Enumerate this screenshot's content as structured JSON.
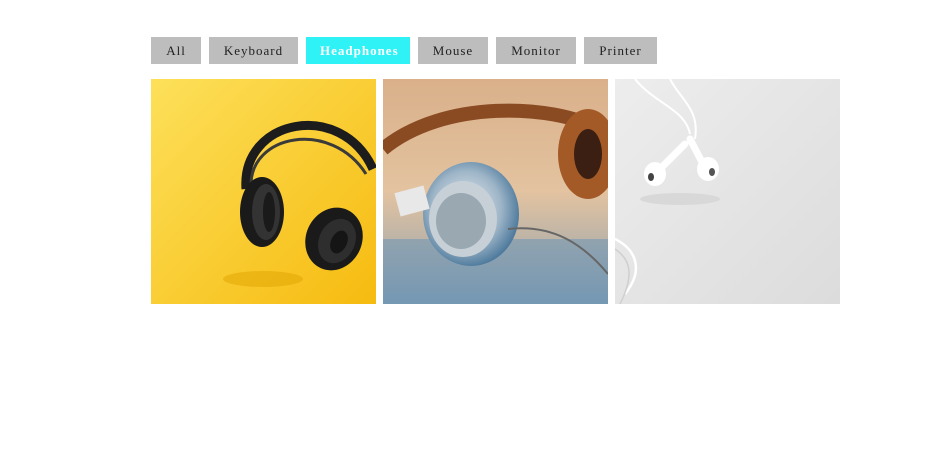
{
  "filters": {
    "all": "All",
    "keyboard": "Keyboard",
    "headphones": "Headphones",
    "mouse": "Mouse",
    "monitor": "Monitor",
    "printer": "Printer",
    "active": "Headphones"
  },
  "gallery": {
    "items": [
      {
        "subject": "headphones",
        "background": "yellow"
      },
      {
        "subject": "headphones",
        "background": "tan"
      },
      {
        "subject": "earphones",
        "background": "white"
      }
    ]
  },
  "colors": {
    "filter_bg": "#bdbdbd",
    "filter_active_bg": "#2ef2f5",
    "filter_active_text": "#ffffff"
  }
}
